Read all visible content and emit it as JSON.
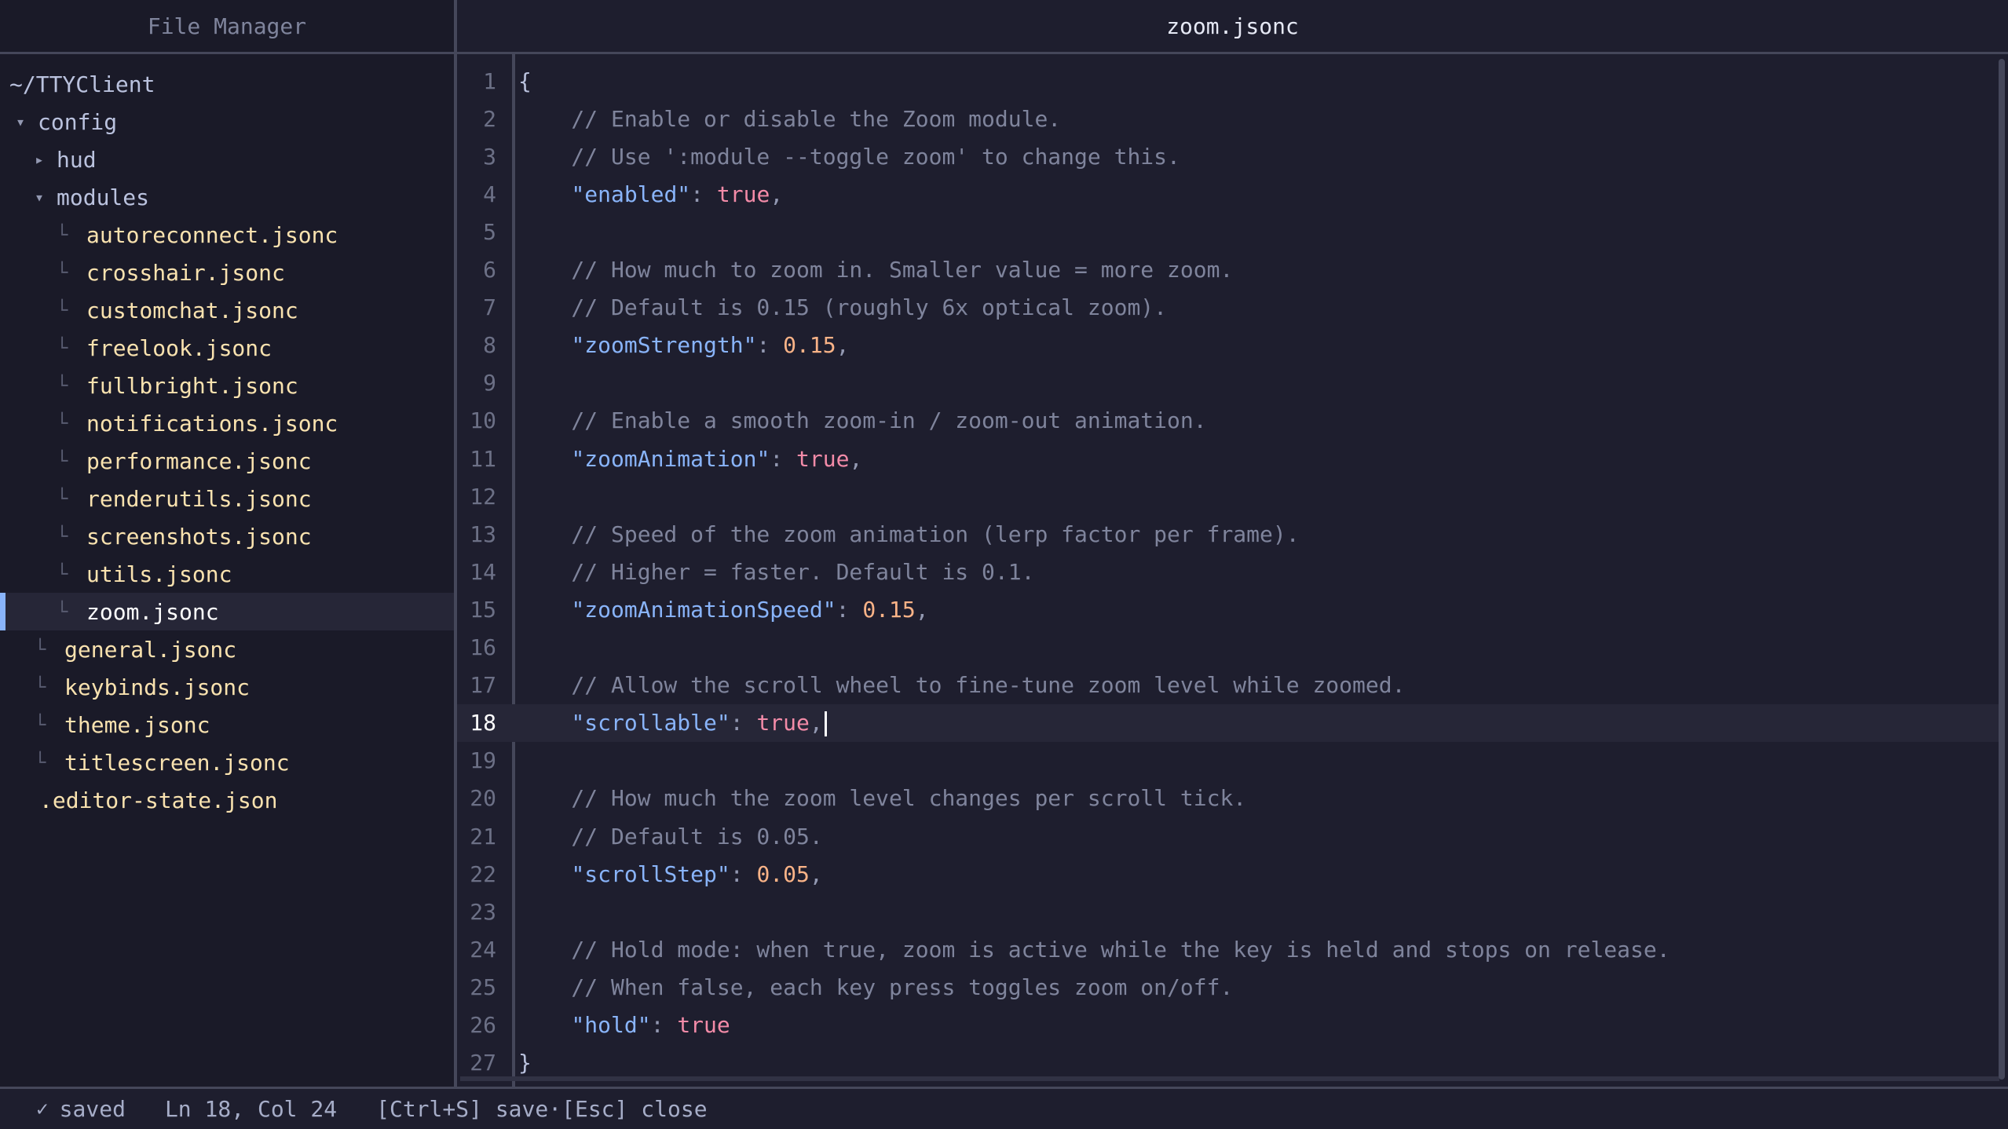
{
  "sidebar": {
    "title": "File Manager",
    "tree": [
      {
        "label": "~/TTYClient",
        "kind": "root",
        "indent": 0,
        "glyph": ""
      },
      {
        "label": "config",
        "kind": "dir",
        "indent": 1,
        "glyph": "▾"
      },
      {
        "label": "hud",
        "kind": "dir",
        "indent": 2,
        "glyph": "▸"
      },
      {
        "label": "modules",
        "kind": "dir",
        "indent": 2,
        "glyph": "▾"
      },
      {
        "label": "autoreconnect.jsonc",
        "kind": "file",
        "indent": 3,
        "glyph": "└"
      },
      {
        "label": "crosshair.jsonc",
        "kind": "file",
        "indent": 3,
        "glyph": "└"
      },
      {
        "label": "customchat.jsonc",
        "kind": "file",
        "indent": 3,
        "glyph": "└"
      },
      {
        "label": "freelook.jsonc",
        "kind": "file",
        "indent": 3,
        "glyph": "└"
      },
      {
        "label": "fullbright.jsonc",
        "kind": "file",
        "indent": 3,
        "glyph": "└"
      },
      {
        "label": "notifications.jsonc",
        "kind": "file",
        "indent": 3,
        "glyph": "└"
      },
      {
        "label": "performance.jsonc",
        "kind": "file",
        "indent": 3,
        "glyph": "└"
      },
      {
        "label": "renderutils.jsonc",
        "kind": "file",
        "indent": 3,
        "glyph": "└"
      },
      {
        "label": "screenshots.jsonc",
        "kind": "file",
        "indent": 3,
        "glyph": "└"
      },
      {
        "label": "utils.jsonc",
        "kind": "file",
        "indent": 3,
        "glyph": "└"
      },
      {
        "label": "zoom.jsonc",
        "kind": "file",
        "indent": 3,
        "glyph": "└",
        "selected": true
      },
      {
        "label": "general.jsonc",
        "kind": "file",
        "indent": 2,
        "glyph": "└"
      },
      {
        "label": "keybinds.jsonc",
        "kind": "file",
        "indent": 2,
        "glyph": "└"
      },
      {
        "label": "theme.jsonc",
        "kind": "file",
        "indent": 2,
        "glyph": "└"
      },
      {
        "label": "titlescreen.jsonc",
        "kind": "file",
        "indent": 2,
        "glyph": "└"
      },
      {
        "label": ".editor-state.json",
        "kind": "file",
        "indent": 1,
        "glyph": ""
      }
    ]
  },
  "editor": {
    "title": "zoom.jsonc",
    "current_line": 18,
    "lines": [
      [
        {
          "t": "{",
          "c": "brace"
        }
      ],
      [
        {
          "t": "    // Enable or disable the Zoom module.",
          "c": "comment"
        }
      ],
      [
        {
          "t": "    // Use ':module --toggle zoom' to change this.",
          "c": "comment"
        }
      ],
      [
        {
          "t": "    ",
          "c": ""
        },
        {
          "t": "\"enabled\"",
          "c": "key"
        },
        {
          "t": ": ",
          "c": "punct"
        },
        {
          "t": "true",
          "c": "bool"
        },
        {
          "t": ",",
          "c": "punct"
        }
      ],
      [],
      [
        {
          "t": "    // How much to zoom in. Smaller value = more zoom.",
          "c": "comment"
        }
      ],
      [
        {
          "t": "    // Default is 0.15 (roughly 6x optical zoom).",
          "c": "comment"
        }
      ],
      [
        {
          "t": "    ",
          "c": ""
        },
        {
          "t": "\"zoomStrength\"",
          "c": "key"
        },
        {
          "t": ": ",
          "c": "punct"
        },
        {
          "t": "0.15",
          "c": "num"
        },
        {
          "t": ",",
          "c": "punct"
        }
      ],
      [],
      [
        {
          "t": "    // Enable a smooth zoom-in / zoom-out animation.",
          "c": "comment"
        }
      ],
      [
        {
          "t": "    ",
          "c": ""
        },
        {
          "t": "\"zoomAnimation\"",
          "c": "key"
        },
        {
          "t": ": ",
          "c": "punct"
        },
        {
          "t": "true",
          "c": "bool"
        },
        {
          "t": ",",
          "c": "punct"
        }
      ],
      [],
      [
        {
          "t": "    // Speed of the zoom animation (lerp factor per frame).",
          "c": "comment"
        }
      ],
      [
        {
          "t": "    // Higher = faster. Default is 0.1.",
          "c": "comment"
        }
      ],
      [
        {
          "t": "    ",
          "c": ""
        },
        {
          "t": "\"zoomAnimationSpeed\"",
          "c": "key"
        },
        {
          "t": ": ",
          "c": "punct"
        },
        {
          "t": "0.15",
          "c": "num"
        },
        {
          "t": ",",
          "c": "punct"
        }
      ],
      [],
      [
        {
          "t": "    // Allow the scroll wheel to fine-tune zoom level while zoomed.",
          "c": "comment"
        }
      ],
      [
        {
          "t": "    ",
          "c": ""
        },
        {
          "t": "\"scrollable\"",
          "c": "key"
        },
        {
          "t": ": ",
          "c": "punct"
        },
        {
          "t": "true",
          "c": "bool"
        },
        {
          "t": ",",
          "c": "punct"
        }
      ],
      [],
      [
        {
          "t": "    // How much the zoom level changes per scroll tick.",
          "c": "comment"
        }
      ],
      [
        {
          "t": "    // Default is 0.05.",
          "c": "comment"
        }
      ],
      [
        {
          "t": "    ",
          "c": ""
        },
        {
          "t": "\"scrollStep\"",
          "c": "key"
        },
        {
          "t": ": ",
          "c": "punct"
        },
        {
          "t": "0.05",
          "c": "num"
        },
        {
          "t": ",",
          "c": "punct"
        }
      ],
      [],
      [
        {
          "t": "    // Hold mode: when true, zoom is active while the key is held and stops on release.",
          "c": "comment"
        }
      ],
      [
        {
          "t": "    // When false, each key press toggles zoom on/off.",
          "c": "comment"
        }
      ],
      [
        {
          "t": "    ",
          "c": ""
        },
        {
          "t": "\"hold\"",
          "c": "key"
        },
        {
          "t": ": ",
          "c": "punct"
        },
        {
          "t": "true",
          "c": "bool"
        }
      ],
      [
        {
          "t": "}",
          "c": "brace"
        }
      ]
    ]
  },
  "status": {
    "check_icon": "✓",
    "saved": "saved",
    "position": "Ln 18, Col 24",
    "hints": "[Ctrl+S] save·[Esc] close"
  },
  "colors": {
    "accent": "#89b4fa",
    "key": "#89b4fa",
    "bool": "#f38ba8",
    "number": "#fab387",
    "comment": "#7f849c",
    "file": "#f9e2af"
  }
}
